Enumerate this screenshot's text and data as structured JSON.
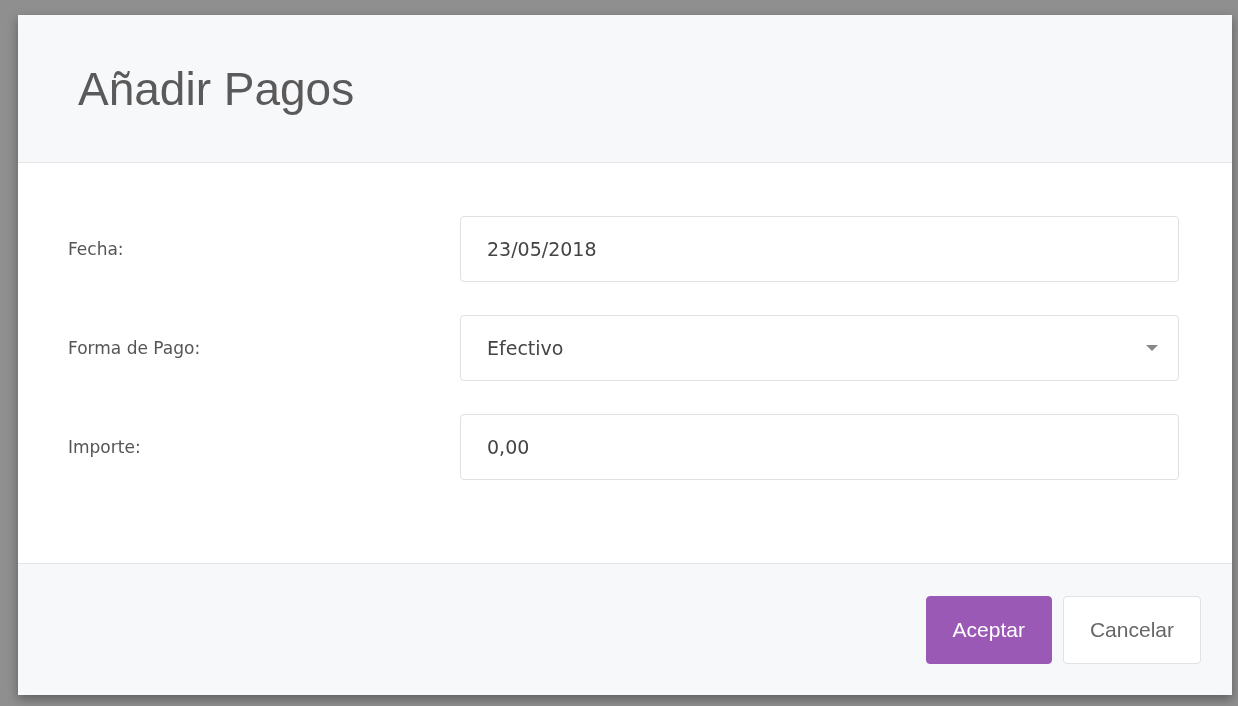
{
  "dialog": {
    "title": "Añadir Pagos",
    "fields": [
      {
        "kind": "text",
        "label": "Fecha:",
        "value": "23/05/2018"
      },
      {
        "kind": "select",
        "label": "Forma de Pago:",
        "value": "Efectivo"
      },
      {
        "kind": "text",
        "label": "Importe:",
        "value": "0,00"
      }
    ],
    "buttons": [
      {
        "label": "Aceptar",
        "kind": "primary"
      },
      {
        "label": "Cancelar",
        "kind": "secondary"
      }
    ]
  }
}
